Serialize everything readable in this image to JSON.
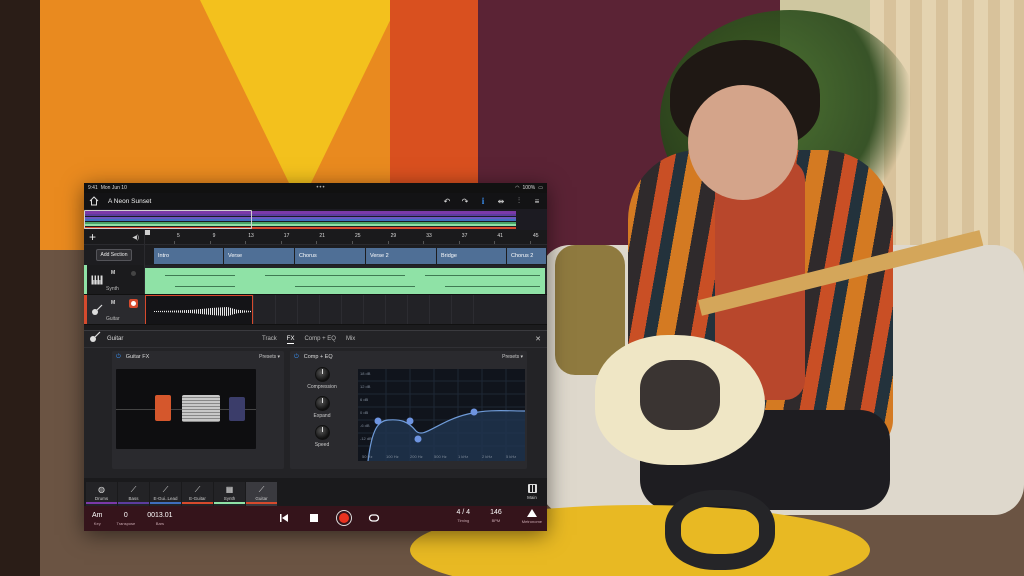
{
  "status": {
    "time": "9:41",
    "date": "Mon Jun 10",
    "battery": "100%"
  },
  "title": {
    "project": "A Neon Sunset"
  },
  "overview_colors": [
    "#7b39a8",
    "#5c3c9e",
    "#6a58c0",
    "#3f6ebd",
    "#4aa36a",
    "#8fe2a6",
    "#d64a2d"
  ],
  "ruler": {
    "bars": [
      "5",
      "9",
      "13",
      "17",
      "21",
      "25",
      "29",
      "33",
      "37",
      "41",
      "45"
    ]
  },
  "sections": {
    "add_label": "Add Section",
    "items": [
      "Intro",
      "Verse",
      "Chorus",
      "Verse 2",
      "Bridge",
      "Chorus 2"
    ]
  },
  "tracks": [
    {
      "name": "Synth",
      "mute": "M",
      "color": "#8fe2a6",
      "icon": "piano-keys-icon"
    },
    {
      "name": "Guitar",
      "mute": "M",
      "color": "#d64a2d",
      "icon": "guitar-icon"
    }
  ],
  "detail": {
    "title": "Guitar",
    "tabs": [
      "Track",
      "FX",
      "Comp + EQ",
      "Mix"
    ],
    "active_tab": "FX",
    "fx": {
      "title": "Guitar FX",
      "presets": "Presets"
    },
    "eq": {
      "title": "Comp + EQ",
      "presets": "Presets",
      "knobs": [
        "Compression",
        "Expand",
        "Speed"
      ],
      "db_labels": [
        "18 dB",
        "12 dB",
        "6 dB",
        "0 dB",
        "-6 dB",
        "-12 dB"
      ],
      "freq_labels": [
        "50 Hz",
        "100 Hz",
        "200 Hz",
        "500 Hz",
        "1 kHz",
        "2 kHz",
        "5 kHz"
      ]
    }
  },
  "instruments": [
    {
      "label": "Drums",
      "color": "#7b39a8",
      "icon": "drum-icon"
    },
    {
      "label": "Bass",
      "color": "#5c3c9e",
      "icon": "guitar-icon"
    },
    {
      "label": "E-Gui..Lead",
      "color": "#3f6ebd",
      "icon": "guitar-icon"
    },
    {
      "label": "E-Guitar",
      "color": "#d64a2d",
      "icon": "guitar-icon"
    },
    {
      "label": "Synth",
      "color": "#8fe2a6",
      "icon": "piano-keys-icon"
    },
    {
      "label": "Guitar",
      "color": "#d64a2d",
      "icon": "guitar-icon"
    }
  ],
  "main_label": "Main",
  "transport": {
    "key": {
      "value": "Am",
      "label": "Key"
    },
    "transpose": {
      "value": "0",
      "label": "Transpose"
    },
    "bars": {
      "value": "0013.01",
      "label": "Bars"
    },
    "timing": {
      "value": "4 / 4",
      "label": "Timing"
    },
    "bpm": {
      "value": "146",
      "label": "BPM"
    },
    "metronome": {
      "label": "Metronome"
    }
  }
}
